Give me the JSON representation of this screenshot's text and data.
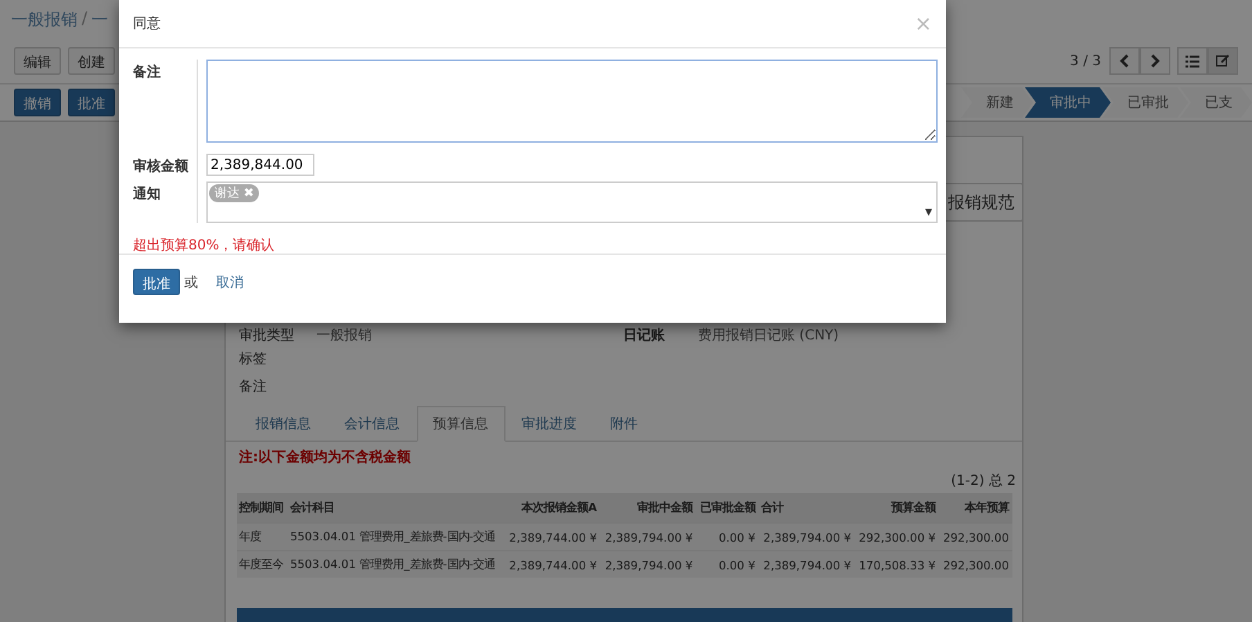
{
  "breadcrumb": {
    "items": [
      "一般报销",
      "一"
    ],
    "separator": "/"
  },
  "toolbar": {
    "buttons": [
      "编辑",
      "创建"
    ],
    "pager": "3 / 3"
  },
  "actions": [
    "撤销",
    "批准"
  ],
  "statusbar": [
    {
      "label": "新建",
      "selected": false
    },
    {
      "label": "审批中",
      "selected": true
    },
    {
      "label": "已审批",
      "selected": false
    },
    {
      "label": "已支",
      "selected": false
    }
  ],
  "sheet": {
    "guide_button": "报销规范",
    "left_fields": [
      {
        "label": "审批类型",
        "value": "一般报销"
      },
      {
        "label": "标签"
      },
      {
        "label": "备注"
      }
    ],
    "right_fields": [
      {
        "label": "日记账",
        "value": "费用报销日记账 (CNY)"
      }
    ],
    "tabs": [
      {
        "label": "报销信息",
        "selected": false
      },
      {
        "label": "会计信息",
        "selected": false
      },
      {
        "label": "预算信息",
        "selected": true
      },
      {
        "label": "审批进度",
        "selected": false
      },
      {
        "label": "附件",
        "selected": false
      }
    ],
    "note": "注:以下金额均为不含税金额",
    "pager": "(1-2) 总 2",
    "table": {
      "columns": [
        "控制期间",
        "会计科目",
        "本次报销金额A",
        "审批中金额",
        "已审批金额",
        "合计",
        "预算金额",
        "本年预算"
      ],
      "rows": [
        [
          "年度",
          "5503.04.01 管理费用_差旅费-国内-交通",
          "2,389,744.00 ¥",
          "2,389,794.00 ¥",
          "0.00 ¥",
          "2,389,794.00 ¥",
          "292,300.00 ¥",
          "292,300.00"
        ],
        [
          "年度至今",
          "5503.04.01 管理费用_差旅费-国内-交通",
          "2,389,744.00 ¥",
          "2,389,794.00 ¥",
          "0.00 ¥",
          "2,389,794.00 ¥",
          "170,508.33 ¥",
          "292,300.00"
        ]
      ]
    }
  },
  "dialog": {
    "title": "同意",
    "close": "×",
    "remark_label": "备注",
    "amount_label": "审核金额",
    "amount_value": "2,389,844.00",
    "notify_label": "通知",
    "notify_tags": [
      {
        "label": "谢达",
        "remove": "✖"
      }
    ],
    "dropdown": "▾",
    "warning": "超出预算80%，请确认",
    "confirm": "批准",
    "or": "或",
    "cancel": "取消"
  }
}
